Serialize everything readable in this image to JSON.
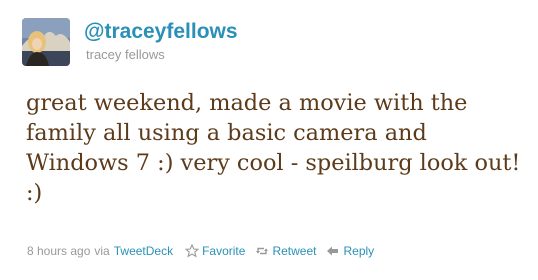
{
  "user": {
    "screen_name": "@traceyfellows",
    "full_name": "tracey fellows"
  },
  "tweet": {
    "text": "great weekend, made a movie with the family all using a basic camera and Windows 7 :) very cool - speilburg look out! :)"
  },
  "meta": {
    "time": "8 hours ago",
    "via": "via",
    "source": "TweetDeck"
  },
  "actions": {
    "favorite": "Favorite",
    "retweet": "Retweet",
    "reply": "Reply"
  },
  "colors": {
    "link": "#2a90b8",
    "tweet_text": "#5c3a1a",
    "meta_text": "#999999"
  },
  "icons": [
    "star-icon",
    "retweet-icon",
    "reply-arrow-icon"
  ]
}
